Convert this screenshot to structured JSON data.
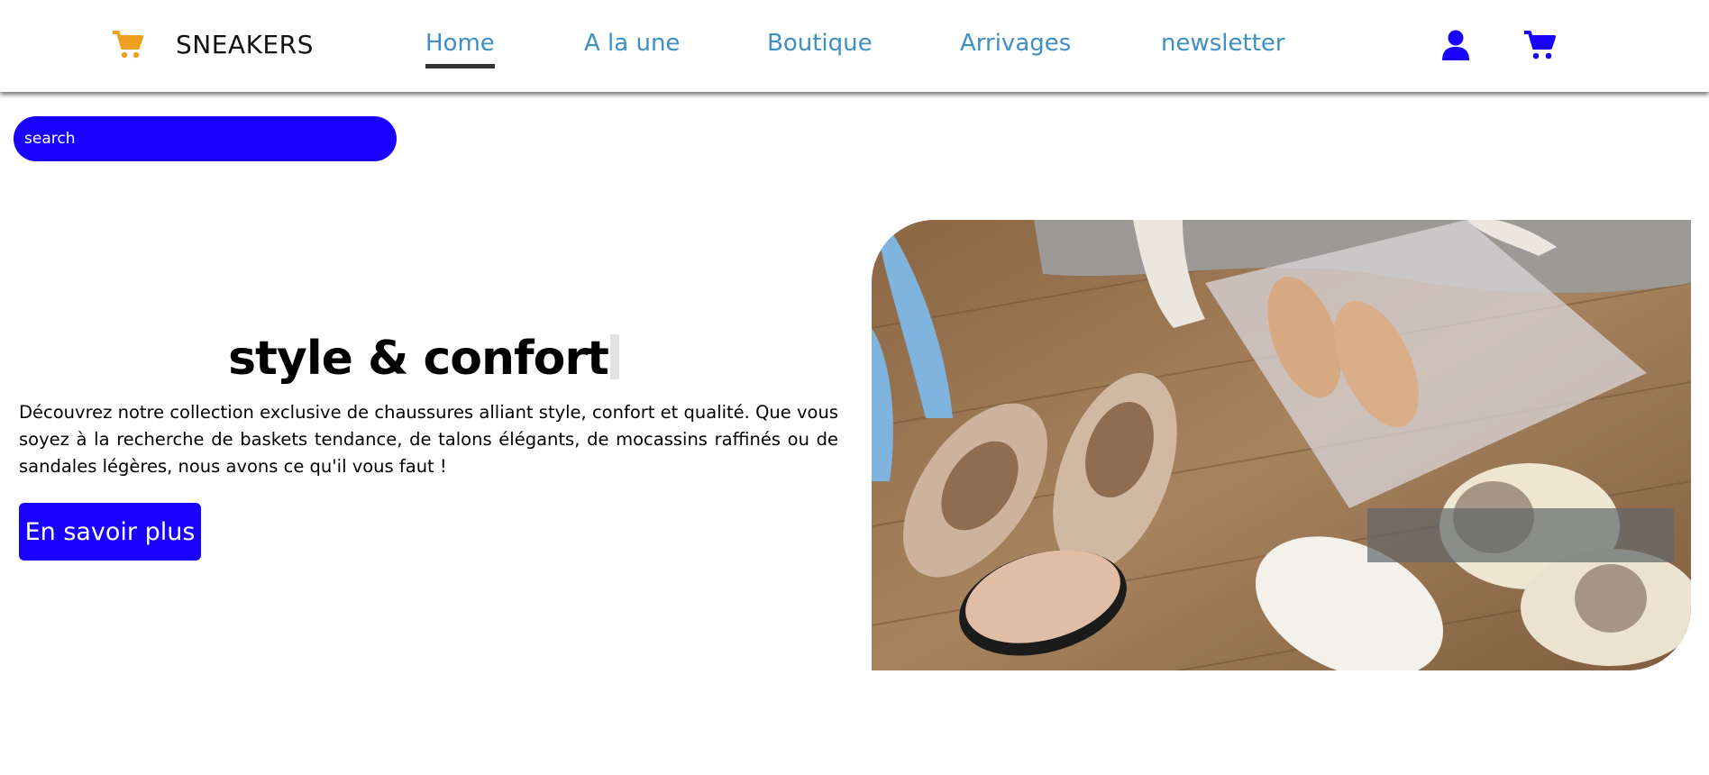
{
  "header": {
    "brand": "SNEAKERS",
    "logo_icon": "cart-icon",
    "nav": [
      {
        "label": "Home",
        "active": true
      },
      {
        "label": "A la une",
        "active": false
      },
      {
        "label": "Boutique",
        "active": false
      },
      {
        "label": "Arrivages",
        "active": false
      },
      {
        "label": "newsletter",
        "active": false
      }
    ],
    "account_icon": "user-icon",
    "cart_icon": "cart-icon"
  },
  "search": {
    "placeholder": "search"
  },
  "hero": {
    "title": "style & confort",
    "description": "Découvrez notre collection exclusive de chaussures alliant style, confort et qualité. Que vous soyez à la recherche de baskets tendance, de talons élégants, de mocassins raffinés ou de sandales légères, nous avons ce qu'il vous faut !",
    "cta_label": "En savoir plus"
  },
  "colors": {
    "accent": "#1900ff",
    "nav_link": "#3d8fc4",
    "logo": "#f0a020"
  }
}
